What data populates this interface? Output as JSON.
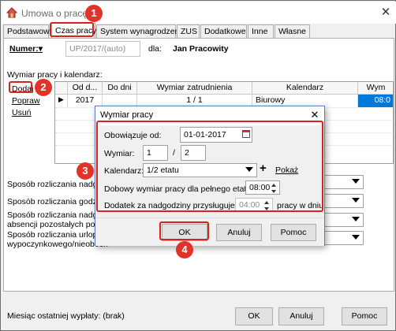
{
  "window": {
    "title": "Umowa o pracę",
    "close": "✕"
  },
  "tabs": [
    "Podstawowe",
    "Czas pracy",
    "System wynagrodzeń",
    "ZUS",
    "Dodatkowe",
    "Inne",
    "Własne"
  ],
  "header": {
    "numer_label": "Numer:▾",
    "numer_value": "UP/2017/(auto)",
    "dla_label": "dla:",
    "employee": "Jan Pracowity"
  },
  "section": {
    "label": "Wymiar pracy i kalendarz:",
    "links": {
      "add": "Dodaj",
      "edit": "Popraw",
      "delete": "Usuń"
    }
  },
  "grid": {
    "headers": [
      "Od d...",
      "Do dni",
      "Wymiar zatrudnienia",
      "Kalendarz",
      "Wym"
    ],
    "row": {
      "marker": "▶",
      "od": "2017",
      "do": "",
      "wymiar": "1 / 1",
      "kalendarz": "Biurowy",
      "wym": "08:0"
    }
  },
  "background_fields": {
    "f1": "Sposób rozliczania nadgodz",
    "f2": "Sposób rozliczania godzin a",
    "f3a": "Sposób rozliczania nadgodz",
    "f3b": "absencji pozostałych po zb",
    "f4a": "Sposób rozliczania urlopu",
    "f4b": "wypoczynkowego/nieobecn"
  },
  "footer": {
    "status": "Miesiąc ostatniej wypłaty: (brak)",
    "ok": "OK",
    "cancel": "Anuluj",
    "help": "Pomoc"
  },
  "dialog": {
    "title": "Wymiar pracy",
    "close": "✕",
    "obowiazuje_label": "Obowiązuje od:",
    "obowiazuje_value": "01-01-2017",
    "wymiar_label": "Wymiar:",
    "wymiar_num": "1",
    "wymiar_sep": "/",
    "wymiar_den": "2",
    "kalendarz_label": "Kalendarz:",
    "kalendarz_value": "1/2 etatu",
    "plus": "+",
    "pokaz": "Pokaż",
    "dobowy_label": "Dobowy wymiar pracy dla pełnego etatu:",
    "dobowy_value": "08:00",
    "dodatek_label": "Dodatek za nadgodziny przysługuje po",
    "dodatek_value": "04:00",
    "dodatek_suffix": "pracy w dniu",
    "ok": "OK",
    "cancel": "Anuluj",
    "help": "Pomoc"
  },
  "badges": [
    "1",
    "2",
    "3",
    "4"
  ],
  "colors": {
    "annotation_red": "#d8221a",
    "badge_red": "#e2322a",
    "selection_blue": "#0078d7"
  }
}
